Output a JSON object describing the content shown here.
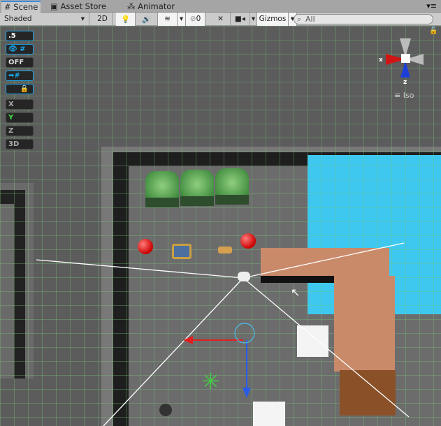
{
  "tabs": [
    {
      "label": "Scene",
      "icon": "grid-icon"
    },
    {
      "label": "Asset Store",
      "icon": "store-icon"
    },
    {
      "label": "Animator",
      "icon": "animator-icon"
    }
  ],
  "toolbar": {
    "shading_mode": "Shaded",
    "mode_2d": "2D",
    "hidden_count": "0",
    "gizmos": "Gizmos",
    "search_placeholder": "All"
  },
  "overlay": {
    "snap_value": ".5",
    "toggle_off": "OFF",
    "axis_x": "X",
    "axis_y": "Y",
    "axis_z": "Z",
    "mode_3d": "3D"
  },
  "gizmo": {
    "x_label": "x",
    "z_label": "z",
    "projection": "Iso"
  },
  "colors": {
    "accent": "#19a7e8",
    "water": "#3ec8f0",
    "brown": "#c98a6a"
  }
}
